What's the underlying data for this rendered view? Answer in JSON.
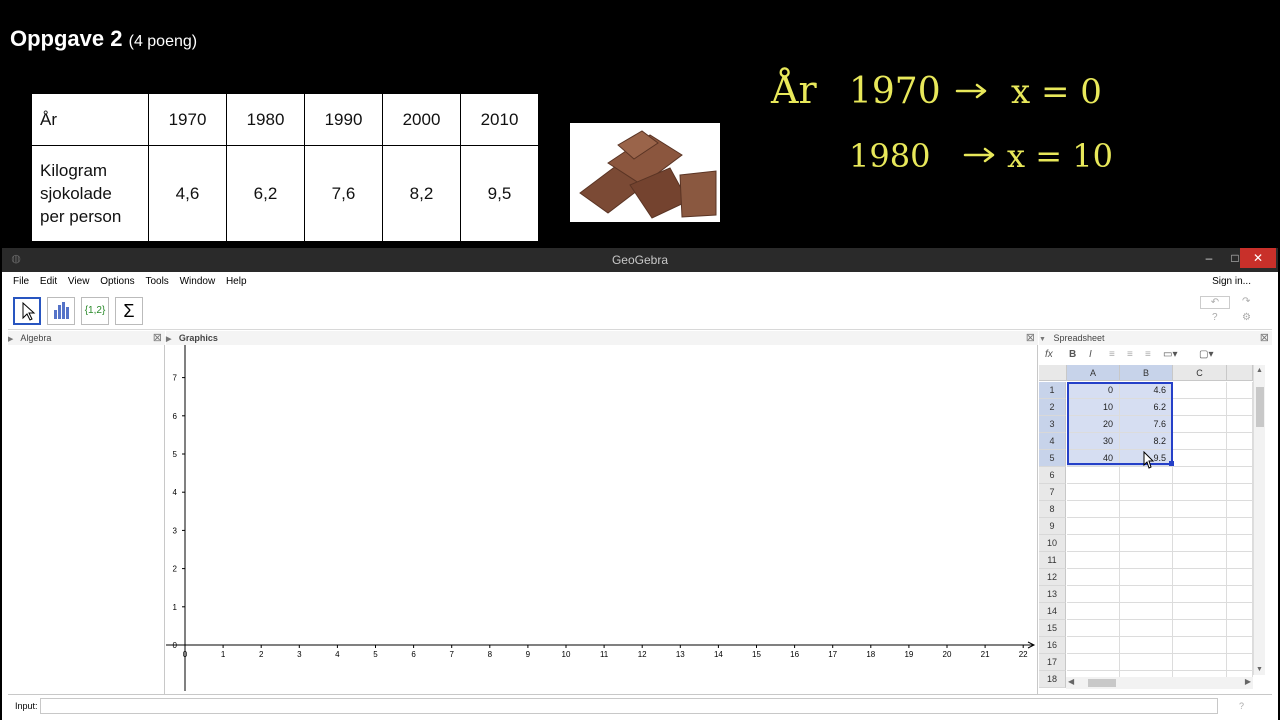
{
  "lesson": {
    "title": "Oppgave 2",
    "points": "(4 poeng)",
    "table": {
      "header_label": "År",
      "years": [
        "1970",
        "1980",
        "1990",
        "2000",
        "2010"
      ],
      "row_label": [
        "Kilogram",
        "sjokolade",
        "per person"
      ],
      "values": [
        "4,6",
        "6,2",
        "7,6",
        "8,2",
        "9,5"
      ]
    },
    "image_alt": "chocolate pieces",
    "notes": {
      "line1_a": "År",
      "line1_b": "1970",
      "line1_c": "x = 0",
      "line2_b": "1980",
      "line2_c": "x = 10",
      "ink_color": "#e8e85a"
    }
  },
  "geogebra": {
    "window_title": "GeoGebra",
    "menu": [
      "File",
      "Edit",
      "View",
      "Options",
      "Tools",
      "Window",
      "Help"
    ],
    "sign_in": "Sign in...",
    "tools": [
      "move-tool",
      "two-variable-analysis-tool",
      "create-list-tool",
      "sum-tool"
    ],
    "tool_glyphs": {
      "list": "{1,2}",
      "sum": "Σ"
    },
    "panels": {
      "algebra": "Algebra",
      "graphics": "Graphics",
      "spreadsheet": "Spreadsheet"
    },
    "graphics_axes": {
      "x_ticks": [
        "0",
        "1",
        "2",
        "3",
        "4",
        "5",
        "6",
        "7",
        "8",
        "9",
        "10",
        "11",
        "12",
        "13",
        "14",
        "15",
        "16",
        "17",
        "18",
        "19",
        "20",
        "21",
        "22"
      ],
      "y_ticks": [
        "0",
        "1",
        "2",
        "3",
        "4",
        "5",
        "6",
        "7"
      ]
    },
    "spreadsheet": {
      "columns": [
        "A",
        "B",
        "C"
      ],
      "row_numbers": [
        "1",
        "2",
        "3",
        "4",
        "5",
        "6",
        "7",
        "8",
        "9",
        "10",
        "11",
        "12",
        "13",
        "14",
        "15",
        "16",
        "17",
        "18"
      ],
      "A": [
        "0",
        "10",
        "20",
        "30",
        "40"
      ],
      "B": [
        "4.6",
        "6.2",
        "7.6",
        "8.2",
        "9.5"
      ],
      "toolbar": {
        "fx": "fx",
        "bold": "B",
        "italic": "I"
      }
    },
    "input_label": "Input:",
    "accent_color": "#2540c8"
  }
}
